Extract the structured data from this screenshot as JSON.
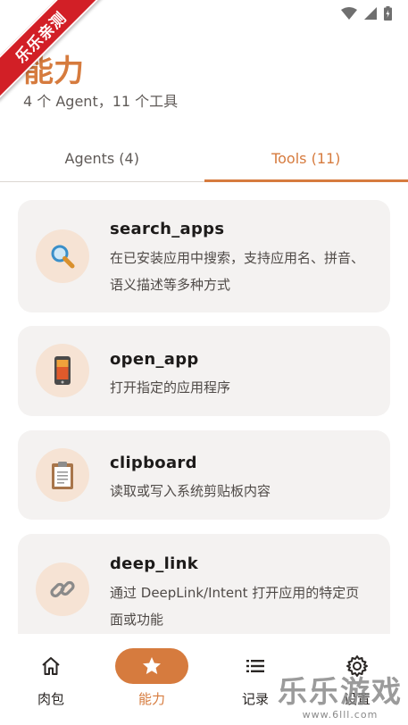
{
  "watermark": {
    "ribbon_text": "乐乐亲测",
    "site_text": "乐乐游戏",
    "site_url": "www.6lll.com"
  },
  "header": {
    "title": "能力",
    "subtitle": "4 个 Agent，11 个工具"
  },
  "tabs": [
    {
      "label": "Agents (4)",
      "active": false
    },
    {
      "label": "Tools (11)",
      "active": true
    }
  ],
  "tools": [
    {
      "name": "search_apps",
      "description": "在已安装应用中搜索，支持应用名、拼音、语义描述等多种方式",
      "icon": "magnifier-icon"
    },
    {
      "name": "open_app",
      "description": "打开指定的应用程序",
      "icon": "mobile-phone-icon"
    },
    {
      "name": "clipboard",
      "description": "读取或写入系统剪贴板内容",
      "icon": "clipboard-icon"
    },
    {
      "name": "deep_link",
      "description": "通过 DeepLink/Intent 打开应用的特定页面或功能",
      "icon": "link-icon"
    }
  ],
  "bottom_nav": [
    {
      "label": "肉包",
      "icon": "home-icon",
      "active": false
    },
    {
      "label": "能力",
      "icon": "star-icon",
      "active": true
    },
    {
      "label": "记录",
      "icon": "list-icon",
      "active": false
    },
    {
      "label": "设置",
      "icon": "gear-icon",
      "active": false
    }
  ],
  "colors": {
    "accent": "#d67b3e",
    "card_bg": "#f4f2f1",
    "icon_circle": "#f6e3d4"
  }
}
